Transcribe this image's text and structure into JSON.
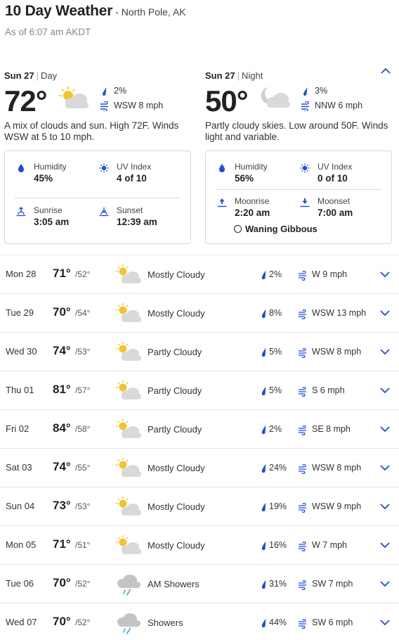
{
  "header": {
    "title": "10 Day Weather",
    "location": "- North Pole, AK",
    "as_of": "As of 6:07 am AKDT"
  },
  "today": {
    "day": {
      "date": "Sun 27",
      "period": "Day",
      "temp": "72°",
      "precip": "2%",
      "wind": "WSW 8 mph",
      "description": "A mix of clouds and sun. High 72F. Winds WSW at 5 to 10 mph.",
      "humidity_label": "Humidity",
      "humidity": "45%",
      "uv_label": "UV Index",
      "uv": "4 of 10",
      "sunrise_label": "Sunrise",
      "sunrise": "3:05 am",
      "sunset_label": "Sunset",
      "sunset": "12:39 am"
    },
    "night": {
      "date": "Sun 27",
      "period": "Night",
      "temp": "50°",
      "precip": "3%",
      "wind": "NNW 6 mph",
      "description": "Partly cloudy skies. Low around 50F. Winds light and variable.",
      "humidity_label": "Humidity",
      "humidity": "56%",
      "uv_label": "UV Index",
      "uv": "0 of 10",
      "moonrise_label": "Moonrise",
      "moonrise": "2:20 am",
      "moonset_label": "Moonset",
      "moonset": "7:00 am",
      "moon_phase": "Waning Gibbous"
    }
  },
  "days": [
    {
      "day": "Mon 28",
      "hi": "71°",
      "lo": "/52°",
      "icon": "partly-cloudy-sun-icon",
      "condition": "Mostly Cloudy",
      "precip": "2%",
      "wind": "W 9 mph"
    },
    {
      "day": "Tue 29",
      "hi": "70°",
      "lo": "/54°",
      "icon": "partly-cloudy-sun-icon",
      "condition": "Mostly Cloudy",
      "precip": "8%",
      "wind": "WSW 13 mph"
    },
    {
      "day": "Wed 30",
      "hi": "74°",
      "lo": "/53°",
      "icon": "partly-cloudy-sun-icon",
      "condition": "Partly Cloudy",
      "precip": "5%",
      "wind": "WSW 8 mph"
    },
    {
      "day": "Thu 01",
      "hi": "81°",
      "lo": "/57°",
      "icon": "partly-cloudy-sun-icon",
      "condition": "Partly Cloudy",
      "precip": "5%",
      "wind": "S 6 mph"
    },
    {
      "day": "Fri 02",
      "hi": "84°",
      "lo": "/58°",
      "icon": "partly-cloudy-sun-icon",
      "condition": "Partly Cloudy",
      "precip": "2%",
      "wind": "SE 8 mph"
    },
    {
      "day": "Sat 03",
      "hi": "74°",
      "lo": "/55°",
      "icon": "partly-cloudy-sun-icon",
      "condition": "Mostly Cloudy",
      "precip": "24%",
      "wind": "WSW 8 mph"
    },
    {
      "day": "Sun 04",
      "hi": "73°",
      "lo": "/53°",
      "icon": "partly-cloudy-sun-icon",
      "condition": "Mostly Cloudy",
      "precip": "19%",
      "wind": "WSW 9 mph"
    },
    {
      "day": "Mon 05",
      "hi": "71°",
      "lo": "/51°",
      "icon": "partly-cloudy-sun-icon",
      "condition": "Mostly Cloudy",
      "precip": "16%",
      "wind": "W 7 mph"
    },
    {
      "day": "Tue 06",
      "hi": "70°",
      "lo": "/52°",
      "icon": "rain-cloud-icon",
      "condition": "AM Showers",
      "precip": "31%",
      "wind": "SW 7 mph"
    },
    {
      "day": "Wed 07",
      "hi": "70°",
      "lo": "/52°",
      "icon": "rain-cloud-icon",
      "condition": "Showers",
      "precip": "44%",
      "wind": "SW 6 mph"
    }
  ],
  "colors": {
    "accent": "#1b4de4",
    "sun": "#f4c430",
    "cloud": "#d9d9d9",
    "text": "#222222",
    "muted": "#888888"
  }
}
